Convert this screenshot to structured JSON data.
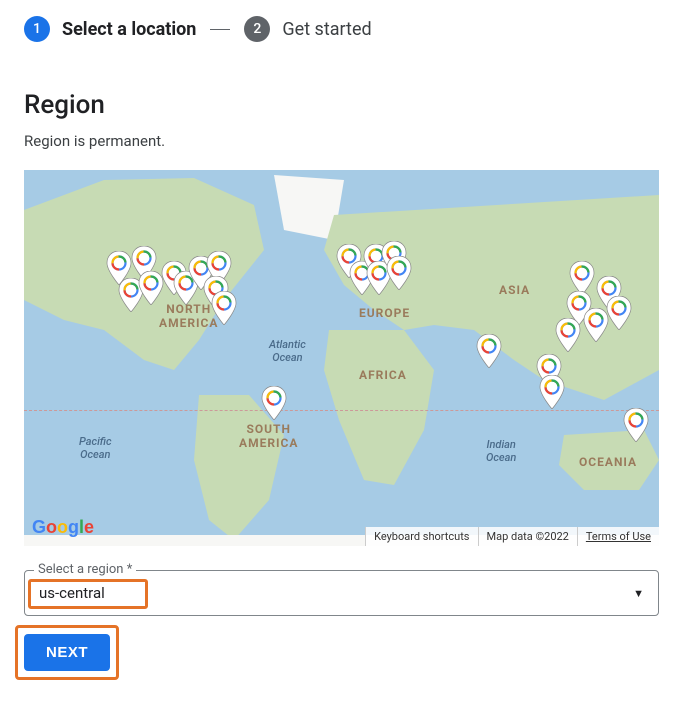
{
  "stepper": {
    "step1": {
      "num": "1",
      "label": "Select a location"
    },
    "step2": {
      "num": "2",
      "label": "Get started"
    }
  },
  "region": {
    "title": "Region",
    "subtitle": "Region is permanent."
  },
  "map": {
    "labels": {
      "north_america": "NORTH\nAMERICA",
      "south_america": "SOUTH\nAMERICA",
      "europe": "EUROPE",
      "africa": "AFRICA",
      "asia": "ASIA",
      "oceania": "OCEANIA",
      "atlantic": "Atlantic\nOcean",
      "indian": "Indian\nOcean",
      "pacific": "Pacific\nOcean"
    },
    "footer": {
      "shortcuts": "Keyboard shortcuts",
      "data": "Map data ©2022",
      "terms": "Terms of Use"
    },
    "logo": "Google"
  },
  "select": {
    "label": "Select a region *",
    "value": "us-central"
  },
  "buttons": {
    "next": "Next"
  }
}
